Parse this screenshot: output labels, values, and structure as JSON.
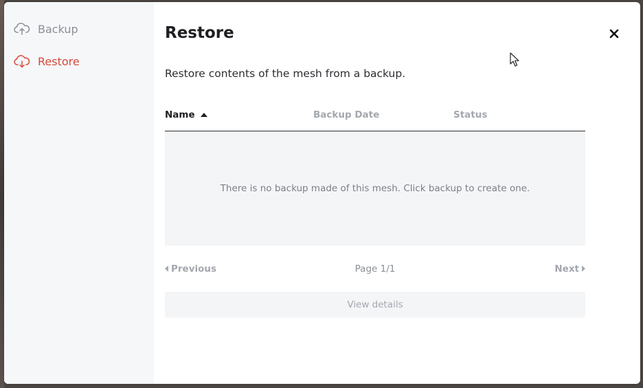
{
  "sidebar": {
    "items": [
      {
        "label": "Backup",
        "icon": "cloud-upload-icon",
        "active": false
      },
      {
        "label": "Restore",
        "icon": "cloud-download-icon",
        "active": true
      }
    ]
  },
  "header": {
    "title": "Restore",
    "close_icon": "close-icon"
  },
  "main": {
    "description": "Restore contents of the mesh from a backup.",
    "table": {
      "columns": [
        "Name",
        "Backup Date",
        "Status"
      ],
      "sort_column": "Name",
      "sort_direction": "ascending",
      "rows": [],
      "empty_message": "There is no backup made of this mesh. Click backup to create one."
    },
    "pagination": {
      "previous_label": "Previous",
      "next_label": "Next",
      "page_label": "Page 1/1"
    },
    "view_details_label": "View details"
  },
  "colors": {
    "accent": "#d6493b",
    "muted": "#a3a7ae",
    "sidebar_bg": "#f6f7f9",
    "empty_bg": "#f4f5f7"
  }
}
